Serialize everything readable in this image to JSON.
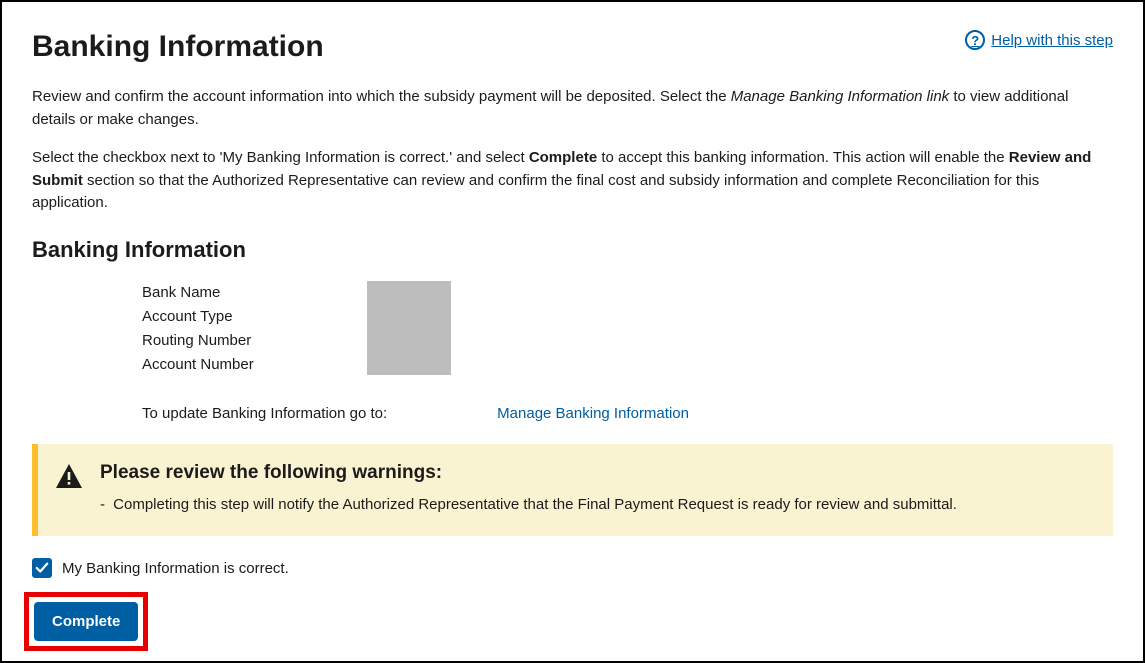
{
  "header": {
    "title": "Banking Information",
    "help_label": " Help with this step"
  },
  "intro": {
    "p1_a": "Review and confirm the account information into which the subsidy payment will be deposited. Select the ",
    "p1_em": "Manage Banking Information link",
    "p1_b": " to view additional details or make changes.",
    "p2_a": "Select the checkbox next to 'My Banking Information is correct.' and select ",
    "p2_s1": "Complete",
    "p2_b": " to accept this banking information. This action will enable the ",
    "p2_s2": "Review and Submit",
    "p2_c": " section so that the Authorized Representative can review and confirm the final cost and subsidy information and complete Reconciliation for this application."
  },
  "section": {
    "title": "Banking Information",
    "labels": {
      "bank_name": "Bank Name",
      "account_type": "Account Type",
      "routing_number": "Routing Number",
      "account_number": "Account Number"
    },
    "update_text": "To update Banking Information go to:",
    "manage_link": "Manage Banking Information"
  },
  "warning": {
    "title": "Please review the following warnings:",
    "item1": "Completing this step will notify the Authorized Representative that the Final Payment Request is ready for review and submittal."
  },
  "confirm": {
    "checkbox_label": "My Banking Information is correct.",
    "checked": true
  },
  "actions": {
    "complete_label": "Complete"
  }
}
